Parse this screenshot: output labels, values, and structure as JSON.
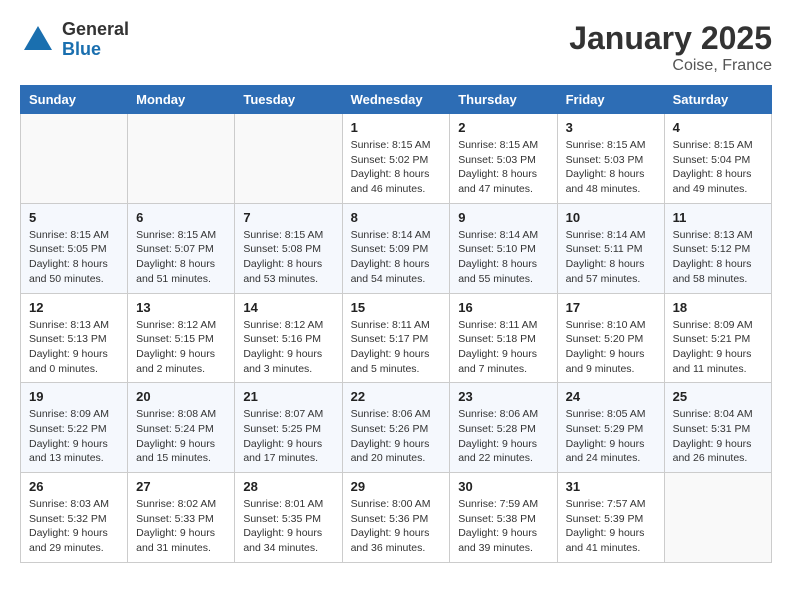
{
  "header": {
    "logo_general": "General",
    "logo_blue": "Blue",
    "title": "January 2025",
    "subtitle": "Coise, France"
  },
  "weekdays": [
    "Sunday",
    "Monday",
    "Tuesday",
    "Wednesday",
    "Thursday",
    "Friday",
    "Saturday"
  ],
  "weeks": [
    [
      {
        "day": "",
        "info": ""
      },
      {
        "day": "",
        "info": ""
      },
      {
        "day": "",
        "info": ""
      },
      {
        "day": "1",
        "info": "Sunrise: 8:15 AM\nSunset: 5:02 PM\nDaylight: 8 hours and 46 minutes."
      },
      {
        "day": "2",
        "info": "Sunrise: 8:15 AM\nSunset: 5:03 PM\nDaylight: 8 hours and 47 minutes."
      },
      {
        "day": "3",
        "info": "Sunrise: 8:15 AM\nSunset: 5:03 PM\nDaylight: 8 hours and 48 minutes."
      },
      {
        "day": "4",
        "info": "Sunrise: 8:15 AM\nSunset: 5:04 PM\nDaylight: 8 hours and 49 minutes."
      }
    ],
    [
      {
        "day": "5",
        "info": "Sunrise: 8:15 AM\nSunset: 5:05 PM\nDaylight: 8 hours and 50 minutes."
      },
      {
        "day": "6",
        "info": "Sunrise: 8:15 AM\nSunset: 5:07 PM\nDaylight: 8 hours and 51 minutes."
      },
      {
        "day": "7",
        "info": "Sunrise: 8:15 AM\nSunset: 5:08 PM\nDaylight: 8 hours and 53 minutes."
      },
      {
        "day": "8",
        "info": "Sunrise: 8:14 AM\nSunset: 5:09 PM\nDaylight: 8 hours and 54 minutes."
      },
      {
        "day": "9",
        "info": "Sunrise: 8:14 AM\nSunset: 5:10 PM\nDaylight: 8 hours and 55 minutes."
      },
      {
        "day": "10",
        "info": "Sunrise: 8:14 AM\nSunset: 5:11 PM\nDaylight: 8 hours and 57 minutes."
      },
      {
        "day": "11",
        "info": "Sunrise: 8:13 AM\nSunset: 5:12 PM\nDaylight: 8 hours and 58 minutes."
      }
    ],
    [
      {
        "day": "12",
        "info": "Sunrise: 8:13 AM\nSunset: 5:13 PM\nDaylight: 9 hours and 0 minutes."
      },
      {
        "day": "13",
        "info": "Sunrise: 8:12 AM\nSunset: 5:15 PM\nDaylight: 9 hours and 2 minutes."
      },
      {
        "day": "14",
        "info": "Sunrise: 8:12 AM\nSunset: 5:16 PM\nDaylight: 9 hours and 3 minutes."
      },
      {
        "day": "15",
        "info": "Sunrise: 8:11 AM\nSunset: 5:17 PM\nDaylight: 9 hours and 5 minutes."
      },
      {
        "day": "16",
        "info": "Sunrise: 8:11 AM\nSunset: 5:18 PM\nDaylight: 9 hours and 7 minutes."
      },
      {
        "day": "17",
        "info": "Sunrise: 8:10 AM\nSunset: 5:20 PM\nDaylight: 9 hours and 9 minutes."
      },
      {
        "day": "18",
        "info": "Sunrise: 8:09 AM\nSunset: 5:21 PM\nDaylight: 9 hours and 11 minutes."
      }
    ],
    [
      {
        "day": "19",
        "info": "Sunrise: 8:09 AM\nSunset: 5:22 PM\nDaylight: 9 hours and 13 minutes."
      },
      {
        "day": "20",
        "info": "Sunrise: 8:08 AM\nSunset: 5:24 PM\nDaylight: 9 hours and 15 minutes."
      },
      {
        "day": "21",
        "info": "Sunrise: 8:07 AM\nSunset: 5:25 PM\nDaylight: 9 hours and 17 minutes."
      },
      {
        "day": "22",
        "info": "Sunrise: 8:06 AM\nSunset: 5:26 PM\nDaylight: 9 hours and 20 minutes."
      },
      {
        "day": "23",
        "info": "Sunrise: 8:06 AM\nSunset: 5:28 PM\nDaylight: 9 hours and 22 minutes."
      },
      {
        "day": "24",
        "info": "Sunrise: 8:05 AM\nSunset: 5:29 PM\nDaylight: 9 hours and 24 minutes."
      },
      {
        "day": "25",
        "info": "Sunrise: 8:04 AM\nSunset: 5:31 PM\nDaylight: 9 hours and 26 minutes."
      }
    ],
    [
      {
        "day": "26",
        "info": "Sunrise: 8:03 AM\nSunset: 5:32 PM\nDaylight: 9 hours and 29 minutes."
      },
      {
        "day": "27",
        "info": "Sunrise: 8:02 AM\nSunset: 5:33 PM\nDaylight: 9 hours and 31 minutes."
      },
      {
        "day": "28",
        "info": "Sunrise: 8:01 AM\nSunset: 5:35 PM\nDaylight: 9 hours and 34 minutes."
      },
      {
        "day": "29",
        "info": "Sunrise: 8:00 AM\nSunset: 5:36 PM\nDaylight: 9 hours and 36 minutes."
      },
      {
        "day": "30",
        "info": "Sunrise: 7:59 AM\nSunset: 5:38 PM\nDaylight: 9 hours and 39 minutes."
      },
      {
        "day": "31",
        "info": "Sunrise: 7:57 AM\nSunset: 5:39 PM\nDaylight: 9 hours and 41 minutes."
      },
      {
        "day": "",
        "info": ""
      }
    ]
  ]
}
